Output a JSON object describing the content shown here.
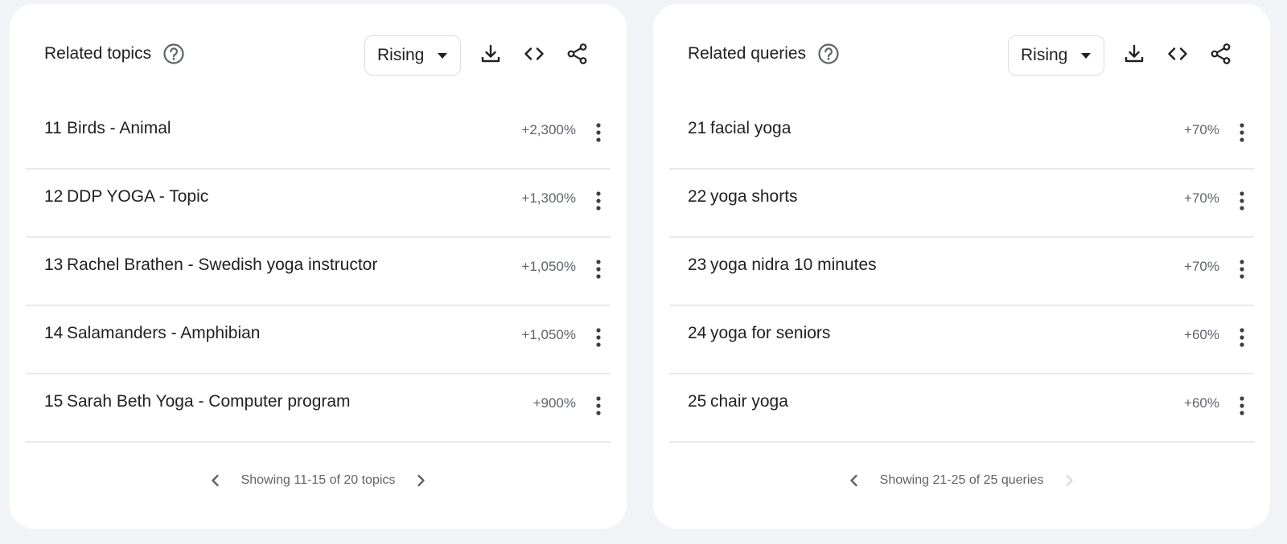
{
  "panels": [
    {
      "title": "Related topics",
      "help_icon": "help-circle-icon",
      "filter": {
        "selected": "Rising"
      },
      "tools": [
        "download-icon",
        "embed-code-icon",
        "share-icon"
      ],
      "rows": [
        {
          "rank": "11",
          "label": "Birds - Animal",
          "value": "+2,300%"
        },
        {
          "rank": "12",
          "label": "DDP YOGA - Topic",
          "value": "+1,300%"
        },
        {
          "rank": "13",
          "label": "Rachel Brathen - Swedish yoga instructor",
          "value": "+1,050%"
        },
        {
          "rank": "14",
          "label": "Salamanders - Amphibian",
          "value": "+1,050%"
        },
        {
          "rank": "15",
          "label": "Sarah Beth Yoga - Computer program",
          "value": "+900%"
        }
      ],
      "pager": {
        "text": "Showing 11-15 of 20 topics",
        "prev_enabled": true,
        "next_enabled": true
      }
    },
    {
      "title": "Related queries",
      "help_icon": "help-circle-icon",
      "filter": {
        "selected": "Rising"
      },
      "tools": [
        "download-icon",
        "embed-code-icon",
        "share-icon"
      ],
      "rows": [
        {
          "rank": "21",
          "label": "facial yoga",
          "value": "+70%"
        },
        {
          "rank": "22",
          "label": "yoga shorts",
          "value": "+70%"
        },
        {
          "rank": "23",
          "label": "yoga nidra 10 minutes",
          "value": "+70%"
        },
        {
          "rank": "24",
          "label": "yoga for seniors",
          "value": "+60%"
        },
        {
          "rank": "25",
          "label": "chair yoga",
          "value": "+60%"
        }
      ],
      "pager": {
        "text": "Showing 21-25 of 25 queries",
        "prev_enabled": true,
        "next_enabled": false
      }
    }
  ],
  "colors": {
    "page_bg": "#f1f3f6",
    "card_bg": "#ffffff",
    "text": "#202124",
    "muted": "#5f6368",
    "divider": "#e8eaed",
    "disabled": "#dadce0"
  }
}
